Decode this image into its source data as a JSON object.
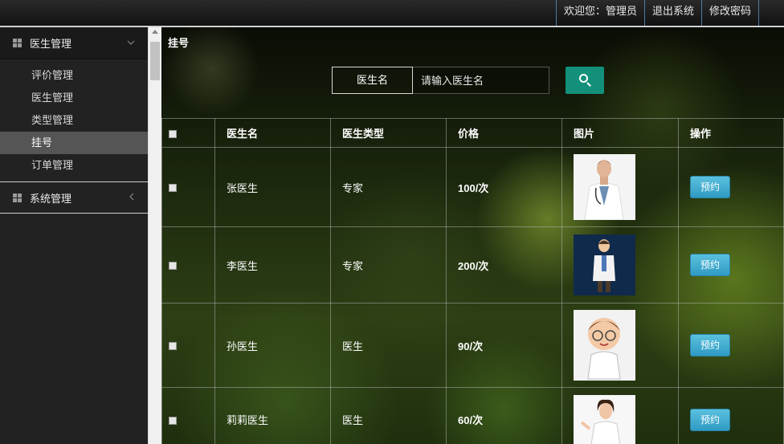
{
  "header": {
    "nav": [
      {
        "label": "欢迎您：管理员"
      },
      {
        "label": "退出系统"
      },
      {
        "label": "修改密码"
      }
    ]
  },
  "sidebar": {
    "groups": [
      {
        "label": "医生管理",
        "expanded": true,
        "items": [
          "评价管理",
          "医生管理",
          "类型管理",
          "挂号",
          "订单管理"
        ],
        "active": "挂号"
      },
      {
        "label": "系统管理",
        "expanded": false
      }
    ]
  },
  "main": {
    "title": "挂号",
    "search": {
      "label": "医生名",
      "placeholder": "请输入医生名"
    },
    "table": {
      "headers": [
        "医生名",
        "医生类型",
        "价格",
        "图片",
        "操作"
      ],
      "rows": [
        {
          "name": "张医生",
          "type": "专家",
          "price": "100/次",
          "action": "预约",
          "image": "male-doctor-photo"
        },
        {
          "name": "李医生",
          "type": "专家",
          "price": "200/次",
          "action": "预约",
          "image": "cartoon-doctor-dark"
        },
        {
          "name": "孙医生",
          "type": "医生",
          "price": "90/次",
          "action": "预约",
          "image": "cartoon-doctor-glasses"
        },
        {
          "name": "莉莉医生",
          "type": "医生",
          "price": "60/次",
          "action": "预约",
          "image": "female-doctor-photo"
        }
      ]
    }
  },
  "colors": {
    "accent": "#12907a",
    "button": "#5bc0de",
    "active_item": "#555555"
  }
}
